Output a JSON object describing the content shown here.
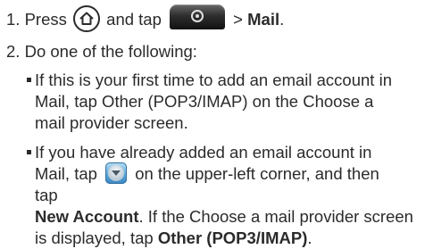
{
  "steps": [
    {
      "number": "1.",
      "text_a": "Press",
      "text_b": "and tap",
      "text_c": ">",
      "text_d": "Mail",
      "text_e": "."
    },
    {
      "number": "2.",
      "text": "Do one of the following:"
    }
  ],
  "bullets": [
    {
      "lines": [
        "If this is your first time to add an email account in",
        "Mail, tap Other (POP3/IMAP) on the Choose a",
        "mail provider screen."
      ]
    },
    {
      "line1": "If you have already added an email account in",
      "line2_a": "Mail, tap",
      "line2_b": "on the upper-left corner, and then",
      "line3": "tap",
      "line4_bold": "New Account",
      "line4_rest": ". If the Choose a mail provider screen",
      "line5_a": "is displayed, tap",
      "line5_bold": "Other (POP3/IMAP)",
      "line5_end": "."
    }
  ],
  "icons": {
    "home": "home-icon",
    "launcher": "launcher-icon",
    "dropdown": "dropdown-arrow-icon"
  }
}
